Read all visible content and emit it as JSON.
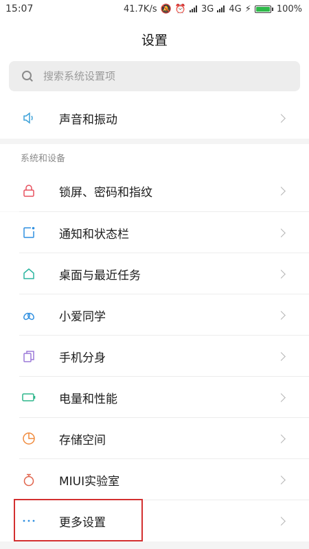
{
  "status_bar": {
    "time": "15:07",
    "net_speed": "41.7K/s",
    "network_3g": "3G",
    "network_4g": "4G",
    "battery": "100%",
    "icons": [
      "mute-icon",
      "alarm-icon",
      "signal-icon",
      "signal-icon",
      "nfc-icon",
      "battery-icon"
    ]
  },
  "header": {
    "title": "设置"
  },
  "search": {
    "placeholder": "搜索系统设置项"
  },
  "top_items": [
    {
      "label": "声音和振动",
      "icon": "speaker-icon",
      "color": "#3aa0d8"
    }
  ],
  "section": {
    "title": "系统和设备",
    "items": [
      {
        "label": "锁屏、密码和指纹",
        "icon": "lock-icon",
        "color": "#e7505f"
      },
      {
        "label": "通知和状态栏",
        "icon": "notification-icon",
        "color": "#2f8fe0"
      },
      {
        "label": "桌面与最近任务",
        "icon": "home-icon",
        "color": "#2cb5a0"
      },
      {
        "label": "小爱同学",
        "icon": "xiaoai-icon",
        "color": "#2f8fe0"
      },
      {
        "label": "手机分身",
        "icon": "second-space-icon",
        "color": "#9b78d8"
      },
      {
        "label": "电量和性能",
        "icon": "battery-icon",
        "color": "#2cb58a"
      },
      {
        "label": "存储空间",
        "icon": "storage-icon",
        "color": "#f08a3c"
      },
      {
        "label": "MIUI实验室",
        "icon": "lab-icon",
        "color": "#e0624a"
      },
      {
        "label": "更多设置",
        "icon": "more-icon",
        "color": "#2f8fe0"
      }
    ]
  },
  "annotation": {
    "highlight_color": "#d32f2f"
  }
}
